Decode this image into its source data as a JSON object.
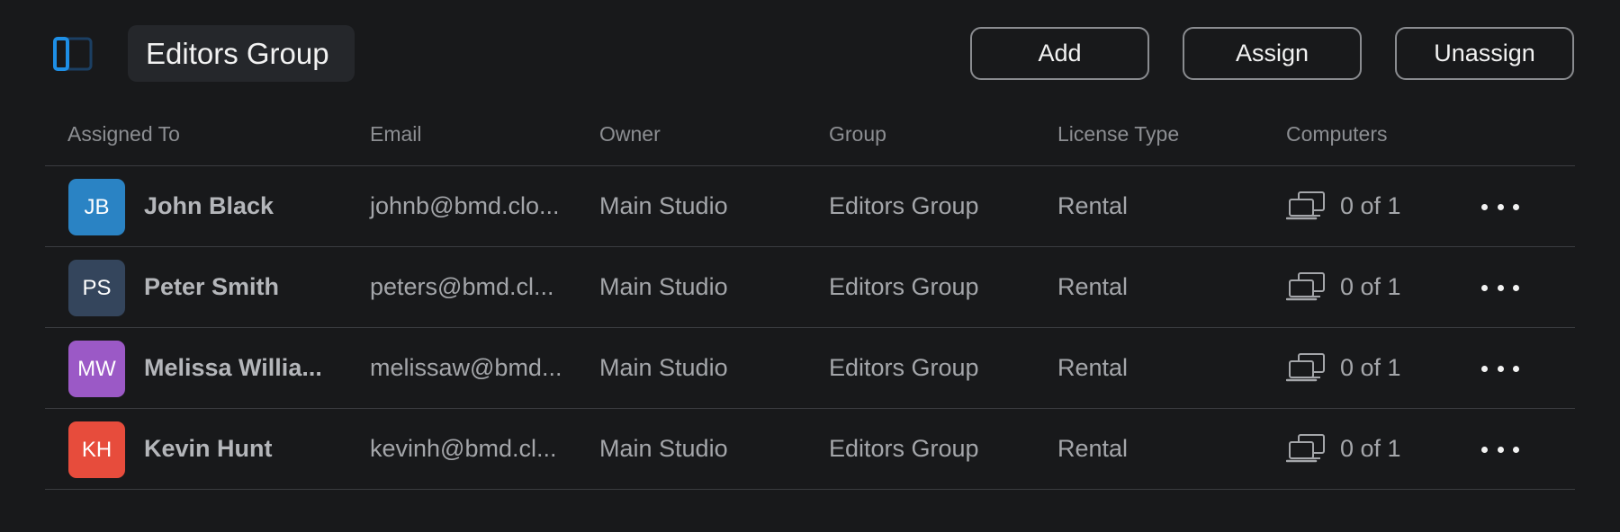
{
  "header": {
    "title": "Editors Group",
    "buttons": {
      "add": "Add",
      "assign": "Assign",
      "unassign": "Unassign"
    },
    "sidebar_toggle_icon": "sidebar-toggle-icon",
    "accent_color": "#1e8fe6"
  },
  "table": {
    "columns": [
      "Assigned To",
      "Email",
      "Owner",
      "Group",
      "License Type",
      "Computers"
    ],
    "rows": [
      {
        "initials": "JB",
        "avatar_color": "#2a83c4",
        "name": "John Black",
        "email": "johnb@bmd.clo...",
        "owner": "Main Studio",
        "group": "Editors Group",
        "license": "Rental",
        "computers": "0 of 1"
      },
      {
        "initials": "PS",
        "avatar_color": "#34455c",
        "name": "Peter Smith",
        "email": "peters@bmd.cl...",
        "owner": "Main Studio",
        "group": "Editors Group",
        "license": "Rental",
        "computers": "0 of 1"
      },
      {
        "initials": "MW",
        "avatar_color": "#9b59c6",
        "name": "Melissa Willia...",
        "email": "melissaw@bmd...",
        "owner": "Main Studio",
        "group": "Editors Group",
        "license": "Rental",
        "computers": "0 of 1"
      },
      {
        "initials": "KH",
        "avatar_color": "#e74c3c",
        "name": "Kevin Hunt",
        "email": "kevinh@bmd.cl...",
        "owner": "Main Studio",
        "group": "Editors Group",
        "license": "Rental",
        "computers": "0 of 1"
      }
    ],
    "row_icons": {
      "computers": "computers-icon",
      "more": "more-options-icon"
    }
  }
}
